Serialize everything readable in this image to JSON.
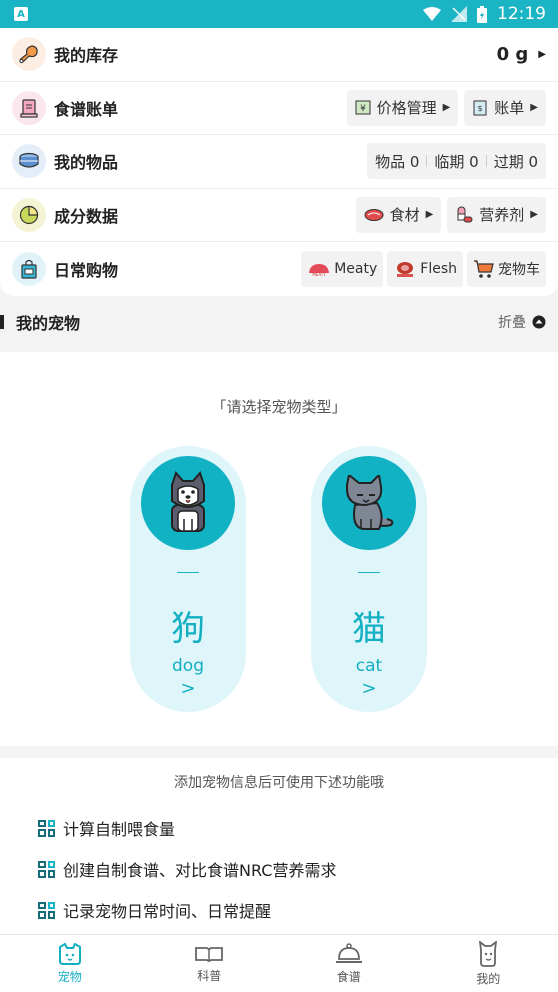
{
  "status": {
    "time": "12:19",
    "notif_letter": "A"
  },
  "rows": [
    {
      "title": "我的库存",
      "value": "0 g"
    },
    {
      "title": "食谱账单",
      "chips": [
        "价格管理",
        "账单"
      ]
    },
    {
      "title": "我的物品",
      "items": [
        "物品 0",
        "临期 0",
        "过期 0"
      ]
    },
    {
      "title": "成分数据",
      "chips": [
        "食材",
        "营养剂"
      ]
    },
    {
      "title": "日常购物",
      "chips": [
        "Meaty",
        "Flesh",
        "宠物车"
      ]
    }
  ],
  "pets": {
    "title": "我的宠物",
    "fold_label": "折叠",
    "select_hint": "「请选择宠物类型」",
    "options": [
      {
        "cn": "狗",
        "en": "dog",
        "arrow": ">"
      },
      {
        "cn": "猫",
        "en": "cat",
        "arrow": ">"
      }
    ]
  },
  "features": {
    "hint": "添加宠物信息后可使用下述功能哦",
    "items": [
      "计算自制喂食量",
      "创建自制食谱、对比食谱NRC营养需求",
      "记录宠物日常时间、日常提醒"
    ]
  },
  "nav": [
    {
      "label": "宠物",
      "icon": "pet-icon",
      "active": true
    },
    {
      "label": "科普",
      "icon": "book-icon",
      "active": false
    },
    {
      "label": "食谱",
      "icon": "cloche-icon",
      "active": false
    },
    {
      "label": "我的",
      "icon": "profile-icon",
      "active": false
    }
  ],
  "colors": {
    "brand": "#1bb4c4",
    "accent": "#13afc2",
    "pill": "#def5fa"
  }
}
